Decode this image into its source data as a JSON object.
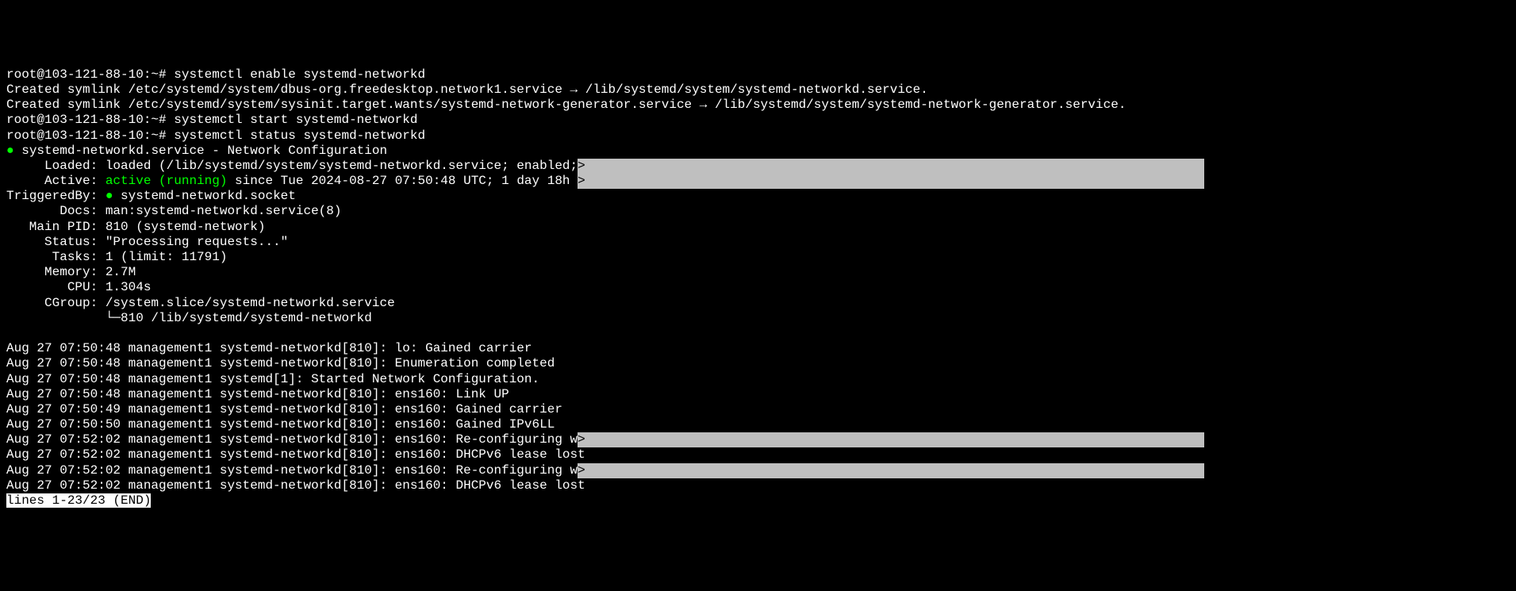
{
  "lines": {
    "l01_prompt": "root@103-121-88-10:~# ",
    "l01_cmd": "systemctl enable systemd-networkd",
    "l02": "Created symlink /etc/systemd/system/dbus-org.freedesktop.network1.service → /lib/systemd/system/systemd-networkd.service.",
    "l03": "Created symlink /etc/systemd/system/sysinit.target.wants/systemd-network-generator.service → /lib/systemd/system/systemd-network-generator.service.",
    "l04_prompt": "root@103-121-88-10:~# ",
    "l04_cmd": "systemctl start systemd-networkd",
    "l05_prompt": "root@103-121-88-10:~# ",
    "l05_cmd": "systemctl status systemd-networkd",
    "l06_dot": "●",
    "l06_text": " systemd-networkd.service - Network Configuration",
    "l07": "     Loaded: loaded (/lib/systemd/system/systemd-networkd.service; enabled;",
    "l07_gt": ">",
    "l08_pre": "     Active: ",
    "l08_active": "active (running)",
    "l08_post": " since Tue 2024-08-27 07:50:48 UTC; 1 day 18h ",
    "l08_gt": ">",
    "l09_pre": "TriggeredBy: ",
    "l09_dot": "●",
    "l09_post": " systemd-networkd.socket",
    "l10": "       Docs: man:systemd-networkd.service(8)",
    "l11": "   Main PID: 810 (systemd-network)",
    "l12": "     Status: \"Processing requests...\"",
    "l13": "      Tasks: 1 (limit: 11791)",
    "l14": "     Memory: 2.7M",
    "l15": "        CPU: 1.304s",
    "l16": "     CGroup: /system.slice/systemd-networkd.service",
    "l17": "             └─810 /lib/systemd/systemd-networkd",
    "l18": "",
    "l19": "Aug 27 07:50:48 management1 systemd-networkd[810]: lo: Gained carrier",
    "l20": "Aug 27 07:50:48 management1 systemd-networkd[810]: Enumeration completed",
    "l21": "Aug 27 07:50:48 management1 systemd[1]: Started Network Configuration.",
    "l22": "Aug 27 07:50:48 management1 systemd-networkd[810]: ens160: Link UP",
    "l23": "Aug 27 07:50:49 management1 systemd-networkd[810]: ens160: Gained carrier",
    "l24": "Aug 27 07:50:50 management1 systemd-networkd[810]: ens160: Gained IPv6LL",
    "l25": "Aug 27 07:52:02 management1 systemd-networkd[810]: ens160: Re-configuring w",
    "l25_gt": ">",
    "l26": "Aug 27 07:52:02 management1 systemd-networkd[810]: ens160: DHCPv6 lease lost",
    "l27": "Aug 27 07:52:02 management1 systemd-networkd[810]: ens160: Re-configuring w",
    "l27_gt": ">",
    "l28": "Aug 27 07:52:02 management1 systemd-networkd[810]: ens160: DHCPv6 lease lost",
    "l29_status": "lines 1-23/23 (END)"
  }
}
